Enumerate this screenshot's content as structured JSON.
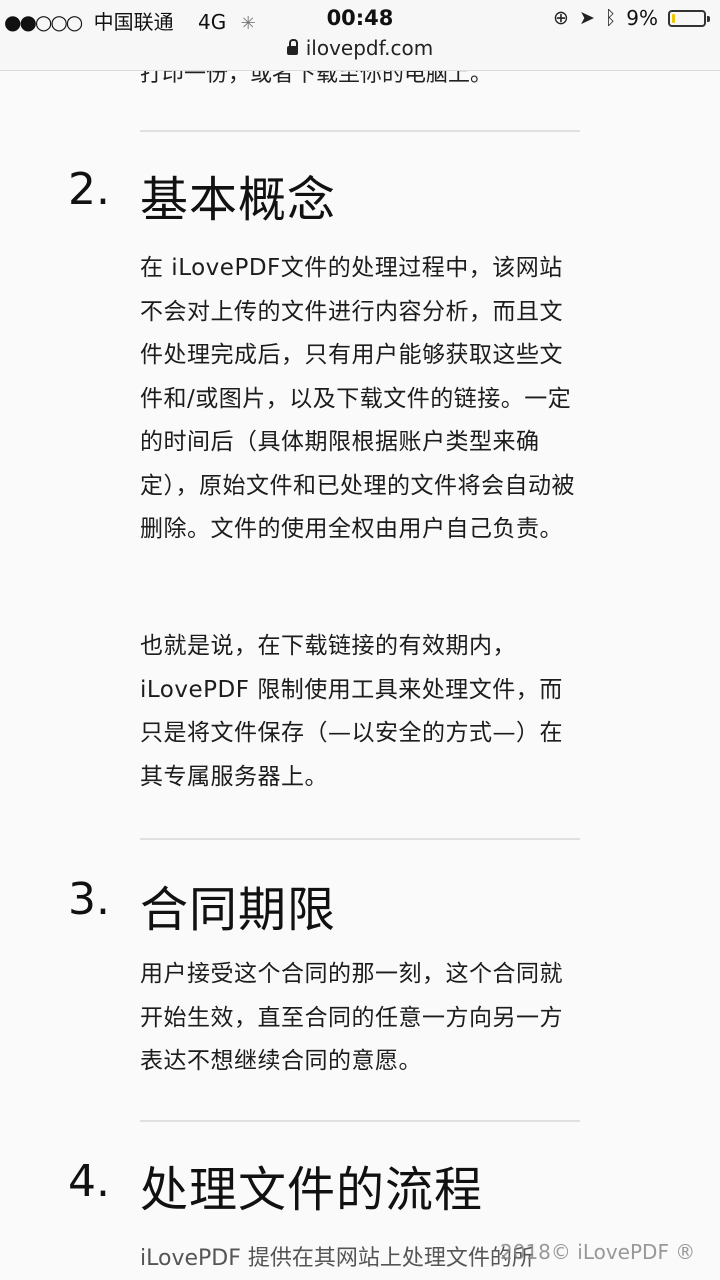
{
  "status_bar": {
    "signal_dots": "●●○○○",
    "carrier": "中国联通",
    "network": "4G",
    "time": "00:48",
    "battery_percent": "9%",
    "battery_level": 0.09,
    "url": "ilovepdf.com"
  },
  "content": {
    "cut_line": "打印一份，或者下载至你的电脑上。",
    "sections": [
      {
        "number": "2.",
        "title": "基本概念",
        "paragraphs": [
          "在 iLovePDF文件的处理过程中，该网站不会对上传的文件进行内容分析，而且文件处理完成后，只有用户能够获取这些文件和/或图片，以及下载文件的链接。一定的时间后（具体期限根据账户类型来确定），原始文件和已处理的文件将会自动被删除。文件的使用全权由用户自己负责。",
          "也就是说，在下载链接的有效期内，iLovePDF 限制使用工具来处理文件，而只是将文件保存（—以安全的方式—）在其专属服务器上。"
        ]
      },
      {
        "number": "3.",
        "title": "合同期限",
        "paragraphs": [
          "用户接受这个合同的那一刻，这个合同就开始生效，直至合同的任意一方向另一方表达不想继续合同的意愿。"
        ]
      },
      {
        "number": "4.",
        "title": "处理文件的流程",
        "paragraphs": []
      }
    ],
    "bottom_line": "iLovePDF 提供在其网站上处理文件的所",
    "footer_mark": "2018© iLovePDF ®"
  }
}
